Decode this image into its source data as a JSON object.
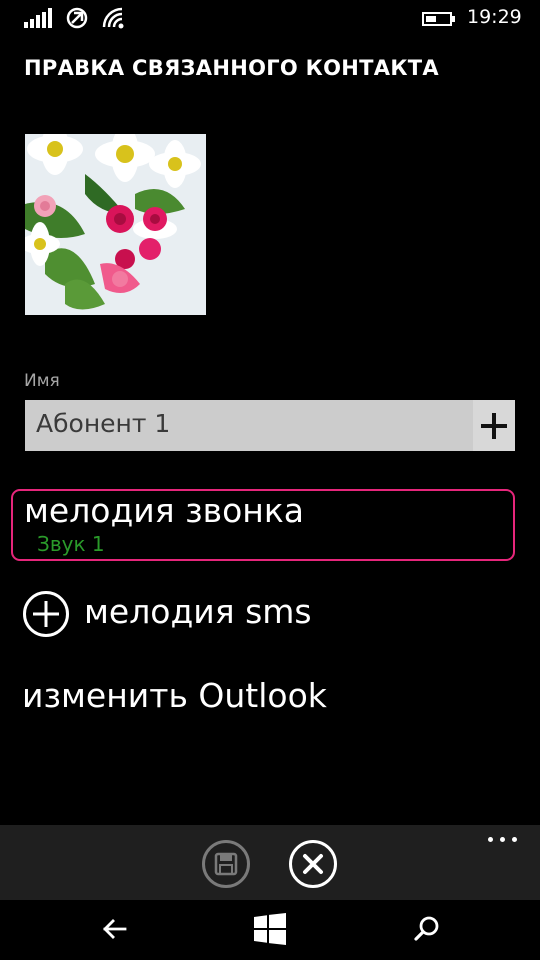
{
  "status_bar": {
    "time": "19:29",
    "icons": [
      "signal-icon",
      "cellular-data-icon",
      "wifi-icon",
      "battery-icon"
    ]
  },
  "header": {
    "title": "ПРАВКА СВЯЗАННОГО КОНТАКТА"
  },
  "contact": {
    "photo": "flower-bouquet-photo",
    "name_label": "Имя",
    "name_value": "Абонент 1"
  },
  "options": {
    "ringtone_title": "мелодия звонка",
    "ringtone_value": "Звук 1",
    "sms_label": "мелодия sms",
    "outlook_label": "изменить Outlook"
  },
  "app_bar": {
    "buttons": [
      "save-icon",
      "cancel-icon"
    ],
    "more": "more-icon"
  },
  "nav_bar": {
    "buttons": [
      "back-arrow-icon",
      "windows-logo-icon",
      "search-icon"
    ]
  },
  "colors": {
    "background": "#000000",
    "accent_border": "#e6267b",
    "ringtone_value": "#2a9a2a",
    "field_background": "#cccccc",
    "app_bar": "#1f1f1f"
  }
}
